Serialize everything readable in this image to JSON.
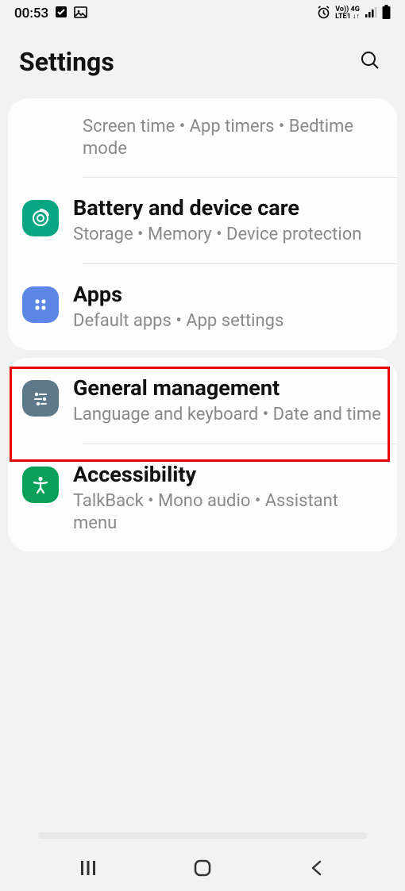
{
  "statusbar": {
    "time": "00:53",
    "net_top": "Vo))  4G",
    "net_bottom": "LTE1 ↓↑"
  },
  "header": {
    "title": "Settings"
  },
  "card1": {
    "item0": {
      "subtitle": "Screen time  •  App timers  •  Bedtime mode"
    },
    "item1": {
      "title": "Battery and device care",
      "subtitle": "Storage  •  Memory  •  Device protection"
    },
    "item2": {
      "title": "Apps",
      "subtitle": "Default apps  •  App settings"
    }
  },
  "card2": {
    "item0": {
      "title": "General management",
      "subtitle": "Language and keyboard  •  Date and time"
    },
    "item1": {
      "title": "Accessibility",
      "subtitle": "TalkBack  •  Mono audio  •  Assistant menu"
    }
  },
  "colors": {
    "battery_icon_bg": "#0aa683",
    "apps_icon_bg": "#5b86e5",
    "general_icon_bg": "#5e7a8a",
    "accessibility_icon_bg": "#0aa05a",
    "highlight_border": "#e60000"
  }
}
